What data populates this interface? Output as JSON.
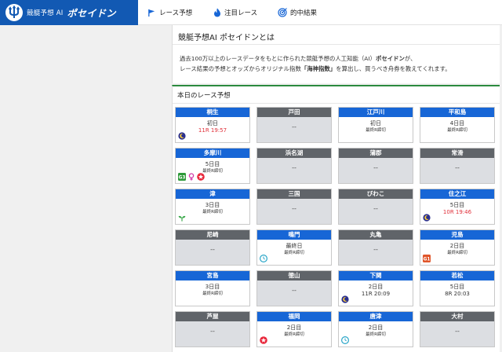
{
  "header": {
    "logo_sub": "競艇予想 AI",
    "logo_main": "ポセイドン",
    "nav": [
      "レース予想",
      "注目レース",
      "的中結果"
    ]
  },
  "intro": {
    "title": "競艇予想AI ポセイドンとは",
    "p1_a": "過去100万以上のレースデータをもとに作られた競艇予想の人工知能（AI）",
    "p1_b": "ポセイドン",
    "p1_c": "が、",
    "p2_a": "レース結果の予想とオッズからオリジナル指数",
    "p2_b": "「海神指数」",
    "p2_c": "を算出し、買うべき舟券を教えてくれます。"
  },
  "today": {
    "title": "本日のレース予想",
    "cards": [
      {
        "name": "桐生",
        "active": true,
        "line1": "初日",
        "line2": "11R 19:57",
        "style": "red",
        "badges": [
          "moon"
        ]
      },
      {
        "name": "戸田",
        "active": false,
        "line1": "--",
        "line2": "",
        "style": "",
        "badges": []
      },
      {
        "name": "江戸川",
        "active": true,
        "line1": "初日",
        "line2": "最終R締切",
        "style": "",
        "badges": []
      },
      {
        "name": "平和島",
        "active": true,
        "line1": "4日目",
        "line2": "最終R締切",
        "style": "",
        "badges": []
      },
      {
        "name": "多摩川",
        "active": true,
        "line1": "5日目",
        "line2": "最終R締切",
        "style": "",
        "badges": [
          "g3",
          "venus",
          "star"
        ]
      },
      {
        "name": "浜名湖",
        "active": false,
        "line1": "--",
        "line2": "",
        "style": "",
        "badges": []
      },
      {
        "name": "蒲郡",
        "active": false,
        "line1": "--",
        "line2": "",
        "style": "",
        "badges": []
      },
      {
        "name": "常滑",
        "active": false,
        "line1": "--",
        "line2": "",
        "style": "",
        "badges": []
      },
      {
        "name": "津",
        "active": true,
        "line1": "3日目",
        "line2": "最終R締切",
        "style": "",
        "badges": [
          "sprout"
        ]
      },
      {
        "name": "三国",
        "active": false,
        "line1": "--",
        "line2": "",
        "style": "",
        "badges": []
      },
      {
        "name": "びわこ",
        "active": false,
        "line1": "--",
        "line2": "",
        "style": "",
        "badges": []
      },
      {
        "name": "住之江",
        "active": true,
        "line1": "5日目",
        "line2": "10R 19:46",
        "style": "red",
        "badges": [
          "moon"
        ]
      },
      {
        "name": "尼崎",
        "active": false,
        "line1": "--",
        "line2": "",
        "style": "",
        "badges": []
      },
      {
        "name": "鳴門",
        "active": true,
        "line1": "最終日",
        "line2": "最終R締切",
        "style": "",
        "badges": [
          "clock"
        ]
      },
      {
        "name": "丸亀",
        "active": false,
        "line1": "--",
        "line2": "",
        "style": "",
        "badges": []
      },
      {
        "name": "児島",
        "active": true,
        "line1": "2日目",
        "line2": "最終R締切",
        "style": "",
        "badges": [
          "g1"
        ]
      },
      {
        "name": "宮島",
        "active": true,
        "line1": "3日目",
        "line2": "最終R締切",
        "style": "",
        "badges": []
      },
      {
        "name": "徳山",
        "active": false,
        "line1": "--",
        "line2": "",
        "style": "",
        "badges": []
      },
      {
        "name": "下関",
        "active": true,
        "line1": "2日目",
        "line2": "11R 20:09",
        "style": "time",
        "badges": [
          "moon"
        ]
      },
      {
        "name": "若松",
        "active": true,
        "line1": "5日目",
        "line2": "8R 20:03",
        "style": "time",
        "badges": []
      },
      {
        "name": "芦屋",
        "active": false,
        "line1": "--",
        "line2": "",
        "style": "",
        "badges": []
      },
      {
        "name": "福岡",
        "active": true,
        "line1": "2日目",
        "line2": "最終R締切",
        "style": "",
        "badges": [
          "star"
        ]
      },
      {
        "name": "唐津",
        "active": true,
        "line1": "2日目",
        "line2": "最終R締切",
        "style": "",
        "badges": [
          "clock"
        ]
      },
      {
        "name": "大村",
        "active": false,
        "line1": "--",
        "line2": "",
        "style": "",
        "badges": []
      }
    ]
  }
}
